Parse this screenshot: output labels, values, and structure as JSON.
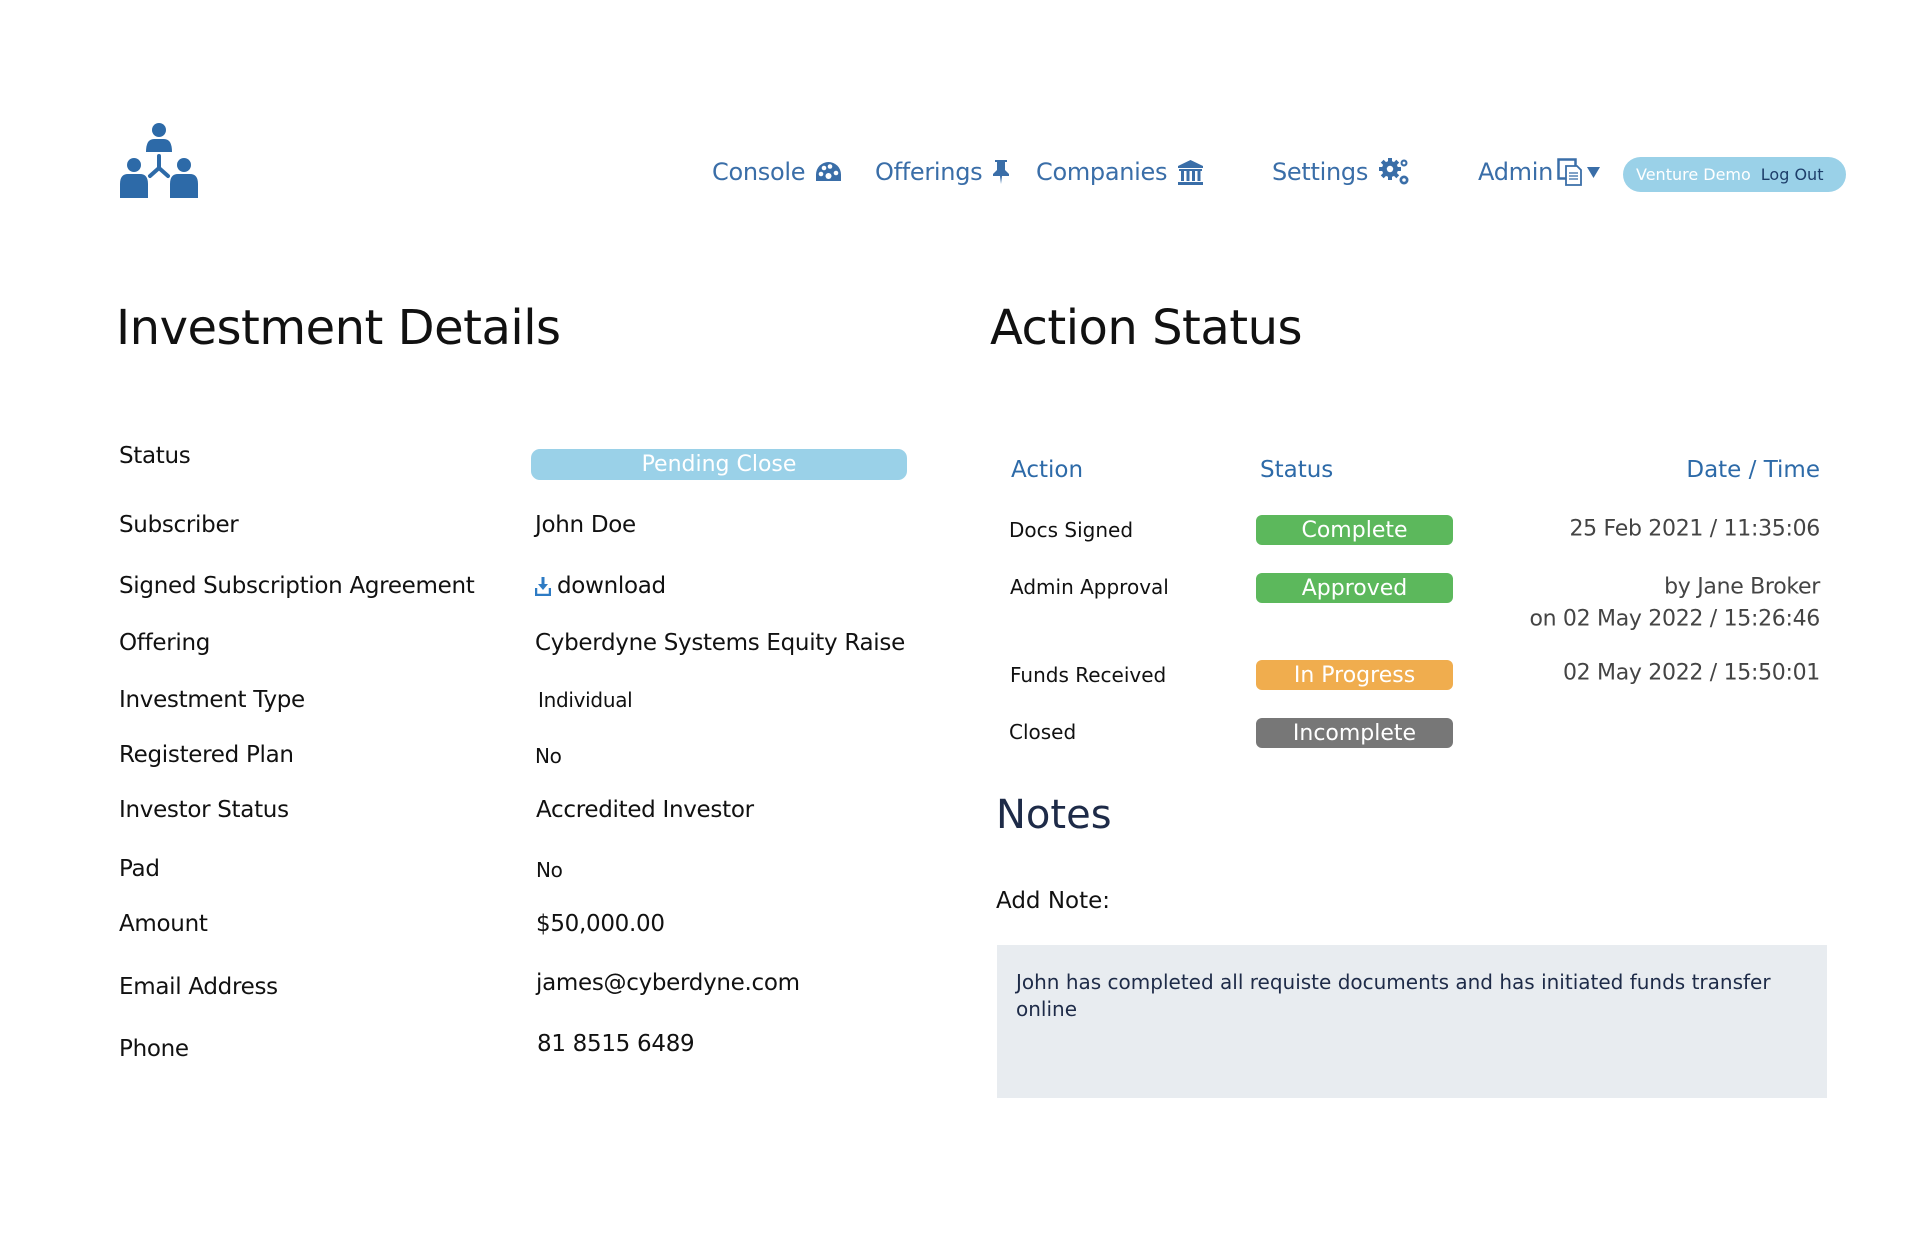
{
  "header": {
    "logo_icon": "people-network-icon",
    "nav": [
      {
        "label": "Console",
        "icon": "dashboard-gauge-icon"
      },
      {
        "label": "Offerings",
        "icon": "pushpin-icon"
      },
      {
        "label": "Companies",
        "icon": "bank-building-icon"
      },
      {
        "label": "Settings",
        "icon": "gears-icon"
      },
      {
        "label": "Admin",
        "icon": "documents-icon",
        "dropdown": "caret-down-icon"
      }
    ],
    "user_name": "Venture Demo",
    "logout_label": "Log Out"
  },
  "investment": {
    "title": "Investment Details",
    "status_label": "Status",
    "status_value": "Pending Close",
    "fields": [
      {
        "label": "Subscriber",
        "value": "John Doe"
      },
      {
        "label": "Signed Subscription Agreement",
        "value": "download",
        "icon": "download-icon"
      },
      {
        "label": "Offering",
        "value": "Cyberdyne Systems Equity Raise"
      },
      {
        "label": "Investment Type",
        "value": "Individual"
      },
      {
        "label": "Registered Plan",
        "value": "No"
      },
      {
        "label": "Investor Status",
        "value": "Accredited Investor"
      },
      {
        "label": "Pad",
        "value": "No"
      },
      {
        "label": "Amount",
        "value": "$50,000.00"
      },
      {
        "label": "Email Address",
        "value": "james@cyberdyne.com"
      },
      {
        "label": "Phone",
        "value": "81 8515 6489"
      }
    ]
  },
  "action_status": {
    "title": "Action Status",
    "columns": [
      "Action",
      "Status",
      "Date / Time"
    ],
    "rows": [
      {
        "action": "Docs Signed",
        "status": "Complete",
        "color": "#5cb85c",
        "datetime": "25 Feb 2021 / 11:35:06"
      },
      {
        "action": "Admin Approval",
        "status": "Approved",
        "color": "#5cb85c",
        "datetime": "by Jane Broker",
        "datetime2": "on 02 May 2022 / 15:26:46"
      },
      {
        "action": "Funds Received",
        "status": "In Progress",
        "color": "#f0ad4e",
        "datetime": "02 May 2022 / 15:50:01"
      },
      {
        "action": "Closed",
        "status": "Incomplete",
        "color": "#777777",
        "datetime": ""
      }
    ]
  },
  "notes": {
    "title": "Notes",
    "add_label": "Add Note:",
    "note_text": "John has completed all requiste documents and has initiated funds transfer online"
  },
  "colors": {
    "nav_blue": "#3a6ea8",
    "header_blue": "#2d6aa8",
    "pill_blue": "#9ad1e8",
    "complete": "#5cb85c",
    "in_progress": "#f0ad4e",
    "incomplete": "#777777"
  }
}
